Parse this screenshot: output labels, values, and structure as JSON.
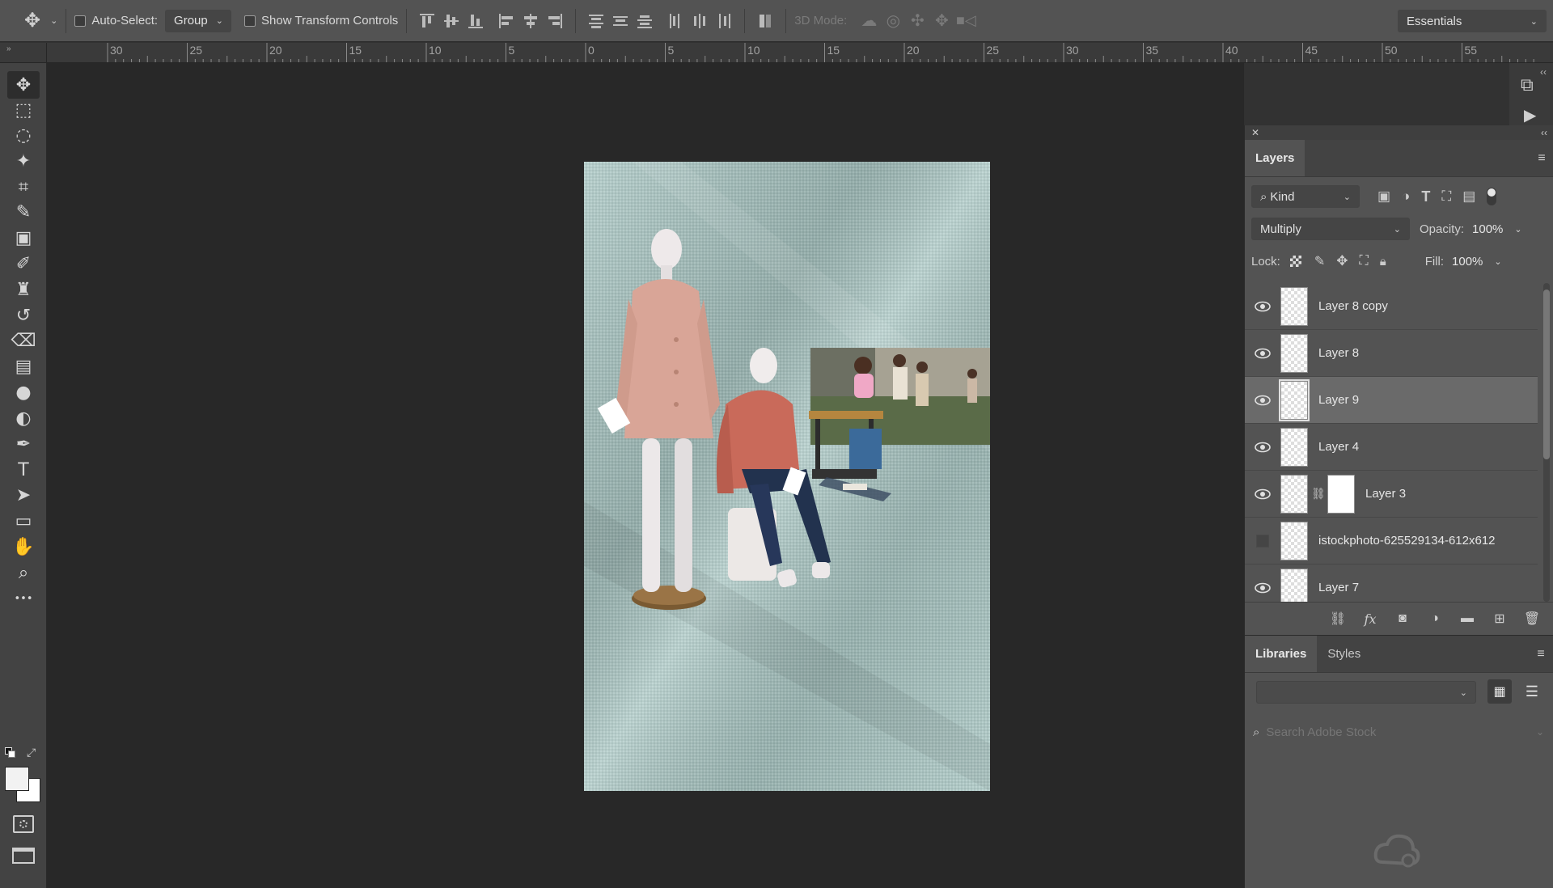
{
  "options_bar": {
    "auto_select_label": "Auto-Select:",
    "auto_select_value": "Group",
    "show_transform_label": "Show Transform Controls",
    "mode_3d_label": "3D Mode:",
    "workspace": "Essentials"
  },
  "ruler": {
    "labels": [
      "30",
      "25",
      "20",
      "15",
      "10",
      "5",
      "0",
      "5",
      "10",
      "15",
      "20",
      "25",
      "30",
      "35",
      "40",
      "45",
      "50",
      "55"
    ],
    "corner": "»"
  },
  "tools": [
    {
      "name": "move-tool",
      "glyph": "✥"
    },
    {
      "name": "marquee-tool",
      "glyph": "⬚"
    },
    {
      "name": "lasso-tool",
      "glyph": "◌"
    },
    {
      "name": "magic-wand-tool",
      "glyph": "✦"
    },
    {
      "name": "crop-tool",
      "glyph": "⌗"
    },
    {
      "name": "eyedropper-tool",
      "glyph": "✎"
    },
    {
      "name": "frame-tool",
      "glyph": "▣"
    },
    {
      "name": "brush-tool",
      "glyph": "✐"
    },
    {
      "name": "stamp-tool",
      "glyph": "♜"
    },
    {
      "name": "history-brush-tool",
      "glyph": "↺"
    },
    {
      "name": "eraser-tool",
      "glyph": "⌫"
    },
    {
      "name": "gradient-tool",
      "glyph": "▤"
    },
    {
      "name": "blur-tool",
      "glyph": "●"
    },
    {
      "name": "dodge-tool",
      "glyph": "◐"
    },
    {
      "name": "pen-tool",
      "glyph": "✒"
    },
    {
      "name": "type-tool",
      "glyph": "T"
    },
    {
      "name": "path-select-tool",
      "glyph": "➤"
    },
    {
      "name": "rectangle-tool",
      "glyph": "▭"
    },
    {
      "name": "hand-tool",
      "glyph": "✋"
    },
    {
      "name": "zoom-tool",
      "glyph": "⌕"
    },
    {
      "name": "more-tools",
      "glyph": "•••"
    }
  ],
  "layers_panel": {
    "tab": "Layers",
    "filter_kind": "Kind",
    "blend_mode": "Multiply",
    "opacity_label": "Opacity:",
    "opacity_value": "100%",
    "lock_label": "Lock:",
    "fill_label": "Fill:",
    "fill_value": "100%",
    "layers": [
      {
        "name": "Layer 8 copy",
        "visible": true,
        "selected": false,
        "mask": false
      },
      {
        "name": "Layer 8",
        "visible": true,
        "selected": false,
        "mask": false
      },
      {
        "name": "Layer 9",
        "visible": true,
        "selected": true,
        "mask": false
      },
      {
        "name": "Layer 4",
        "visible": true,
        "selected": false,
        "mask": false
      },
      {
        "name": "Layer 3",
        "visible": true,
        "selected": false,
        "mask": true
      },
      {
        "name": "istockphoto-625529134-612x612",
        "visible": false,
        "selected": false,
        "mask": false
      },
      {
        "name": "Layer 7",
        "visible": true,
        "selected": false,
        "mask": false
      }
    ]
  },
  "libraries_panel": {
    "tab_libraries": "Libraries",
    "tab_styles": "Styles",
    "search_placeholder": "Search Adobe Stock"
  },
  "colors": {
    "canvas_bg": "#282828",
    "panel_bg": "#535353",
    "fabric": "#a9c4c1",
    "coat_standing": "#d9a597",
    "coat_seated": "#c96a5a"
  }
}
